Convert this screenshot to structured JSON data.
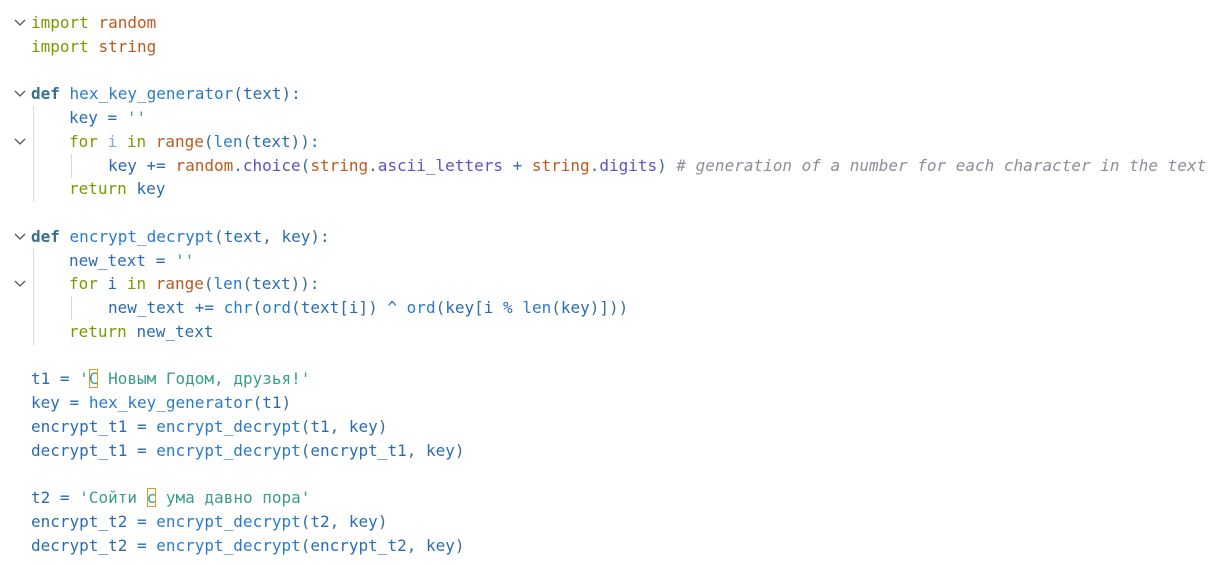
{
  "editor": {
    "language": "python",
    "colors": {
      "background": "#ffffff",
      "keyword": "#7a9a00",
      "module": "#c0591f",
      "function": "#2a7bcb",
      "string": "#3a9c8a",
      "comment": "#8a8f98",
      "highlight_border": "#d99a2a"
    },
    "lines": {
      "l1": {
        "t1": "import",
        "t2": "random"
      },
      "l2": {
        "t1": "import",
        "t2": "string"
      },
      "l4": {
        "def": "def",
        "name": "hex_key_generator",
        "open": "(",
        "param": "text",
        "close": "):"
      },
      "l5": {
        "a": "key",
        "b": " = ",
        "c": "''"
      },
      "l6": {
        "for": "for",
        "i": "i",
        "in": "in",
        "range": "range",
        "p1": "(",
        "len": "len",
        "p2": "(",
        "text": "text",
        "p3": "))",
        "colon": ":"
      },
      "l7": {
        "key": "key",
        "op": " += ",
        "random": "random",
        "dot1": ".",
        "choice": "choice",
        "p1": "(",
        "string1": "string",
        "dot2": ".",
        "ascii": "ascii_letters",
        "plus": " + ",
        "string2": "string",
        "dot3": ".",
        "digits": "digits",
        "p2": ")",
        "comment": " # generation of a number for each character in the text"
      },
      "l8": {
        "return": "return",
        "key": "key"
      },
      "l10": {
        "def": "def",
        "name": "encrypt_decrypt",
        "open": "(",
        "param1": "text",
        "comma": ", ",
        "param2": "key",
        "close": "):"
      },
      "l11": {
        "a": "new_text",
        "b": " = ",
        "c": "''"
      },
      "l12": {
        "for": "for",
        "i": "i",
        "in": "in",
        "range": "range",
        "p1": "(",
        "len": "len",
        "p2": "(",
        "text": "text",
        "p3": "))",
        "colon": ":"
      },
      "l13": {
        "nt": "new_text",
        "op": " += ",
        "chr": "chr",
        "p1": "(",
        "ord1": "ord",
        "p2": "(",
        "text": "text",
        "b1": "[",
        "i1": "i",
        "b2": "])",
        "xor": " ^ ",
        "ord2": "ord",
        "p3": "(",
        "key": "key",
        "b3": "[",
        "i2": "i",
        "mod": " % ",
        "len": "len",
        "p4": "(",
        "key2": "key",
        "p5": ")]))"
      },
      "l14": {
        "return": "return",
        "nt": "new_text"
      },
      "l16": {
        "a": "t1",
        "b": " = ",
        "q1": "'",
        "hl": "С",
        "rest": " Новым Годом, друзья!'"
      },
      "l17": {
        "a": "key",
        "b": " = ",
        "fn": "hex_key_generator",
        "p1": "(",
        "arg": "t1",
        "p2": ")"
      },
      "l18": {
        "a": "encrypt_t1",
        "b": " = ",
        "fn": "encrypt_decrypt",
        "p1": "(",
        "arg1": "t1",
        "c": ", ",
        "arg2": "key",
        "p2": ")"
      },
      "l19": {
        "a": "decrypt_t1",
        "b": " = ",
        "fn": "encrypt_decrypt",
        "p1": "(",
        "arg1": "encrypt_t1",
        "c": ", ",
        "arg2": "key",
        "p2": ")"
      },
      "l21": {
        "a": "t2",
        "b": " = ",
        "s1": "'Сойти ",
        "hl": "с",
        "s2": " ума давно пора'"
      },
      "l22": {
        "a": "encrypt_t2",
        "b": " = ",
        "fn": "encrypt_decrypt",
        "p1": "(",
        "arg1": "t2",
        "c": ", ",
        "arg2": "key",
        "p2": ")"
      },
      "l23": {
        "a": "decrypt_t2",
        "b": " = ",
        "fn": "encrypt_decrypt",
        "p1": "(",
        "arg1": "encrypt_t2",
        "c": ", ",
        "arg2": "key",
        "p2": ")"
      }
    }
  }
}
